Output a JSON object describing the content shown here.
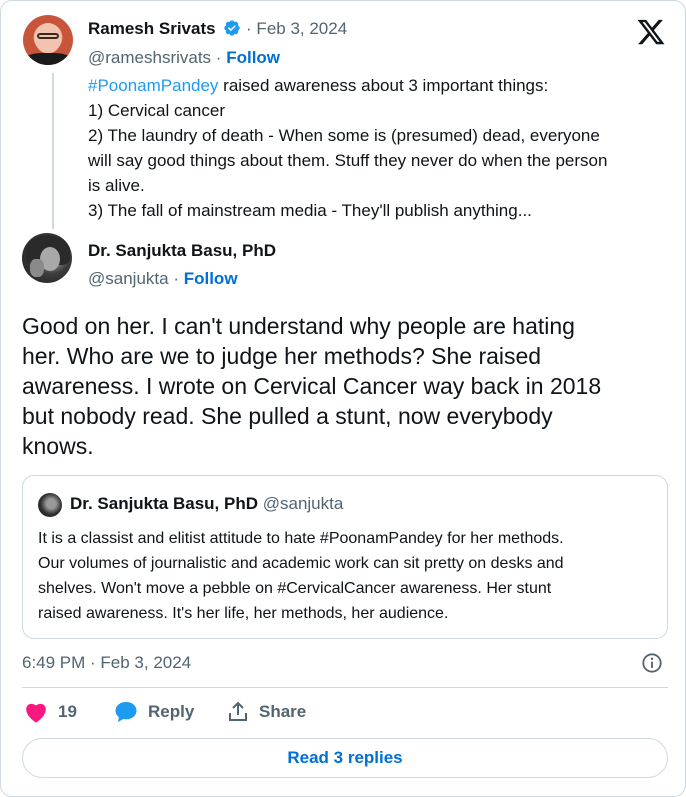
{
  "parent_tweet": {
    "author_name": "Ramesh Srivats",
    "separator_date": "· Feb 3, 2024",
    "handle": "@rameshsrivats",
    "follow_sep": "·",
    "follow_label": "Follow",
    "hashtag": "#PoonamPandey",
    "lines": [
      " raised awareness about 3 important things:",
      "1) Cervical cancer",
      "2) The laundry of death - When some is (presumed) dead, everyone",
      "will say good things about them. Stuff they never do when the person",
      "is alive.",
      "3) The fall of mainstream media - They'll publish anything..."
    ]
  },
  "main_tweet": {
    "author_name": "Dr. Sanjukta Basu, PhD",
    "handle": "@sanjukta",
    "follow_sep": "·",
    "follow_label": "Follow",
    "lines": [
      "Good on her. I can't understand why people are hating",
      "her. Who are we to judge her methods? She raised",
      "awareness. I wrote on Cervical Cancer way back in 2018",
      "but nobody read. She pulled a stunt, now everybody",
      "knows."
    ],
    "timestamp": "6:49 PM · Feb 3, 2024"
  },
  "quote_tweet": {
    "author_name": "Dr. Sanjukta Basu, PhD",
    "handle": "@sanjukta",
    "lines": [
      "It is a classist and elitist attitude to hate #PoonamPandey for her methods.",
      "Our volumes of journalistic and academic work can sit pretty on desks and",
      "shelves. Won't move a pebble on #CervicalCancer awareness. Her stunt",
      "raised awareness. It's her life, her methods, her audience."
    ]
  },
  "actions": {
    "like_count": "19",
    "reply_label": "Reply",
    "share_label": "Share"
  },
  "read_replies_label": "Read 3 replies",
  "icons": {
    "brand": "x-logo-icon",
    "verified": "verified-badge-icon",
    "info": "info-icon",
    "like": "heart-icon",
    "reply": "speech-bubble-icon",
    "share": "share-upload-icon"
  },
  "colors": {
    "link": "#006fd6",
    "hashtag": "#1d9bf0",
    "like": "#f91880",
    "verified": "#1d9bf0",
    "muted": "#536471",
    "border": "#cfd9de"
  }
}
